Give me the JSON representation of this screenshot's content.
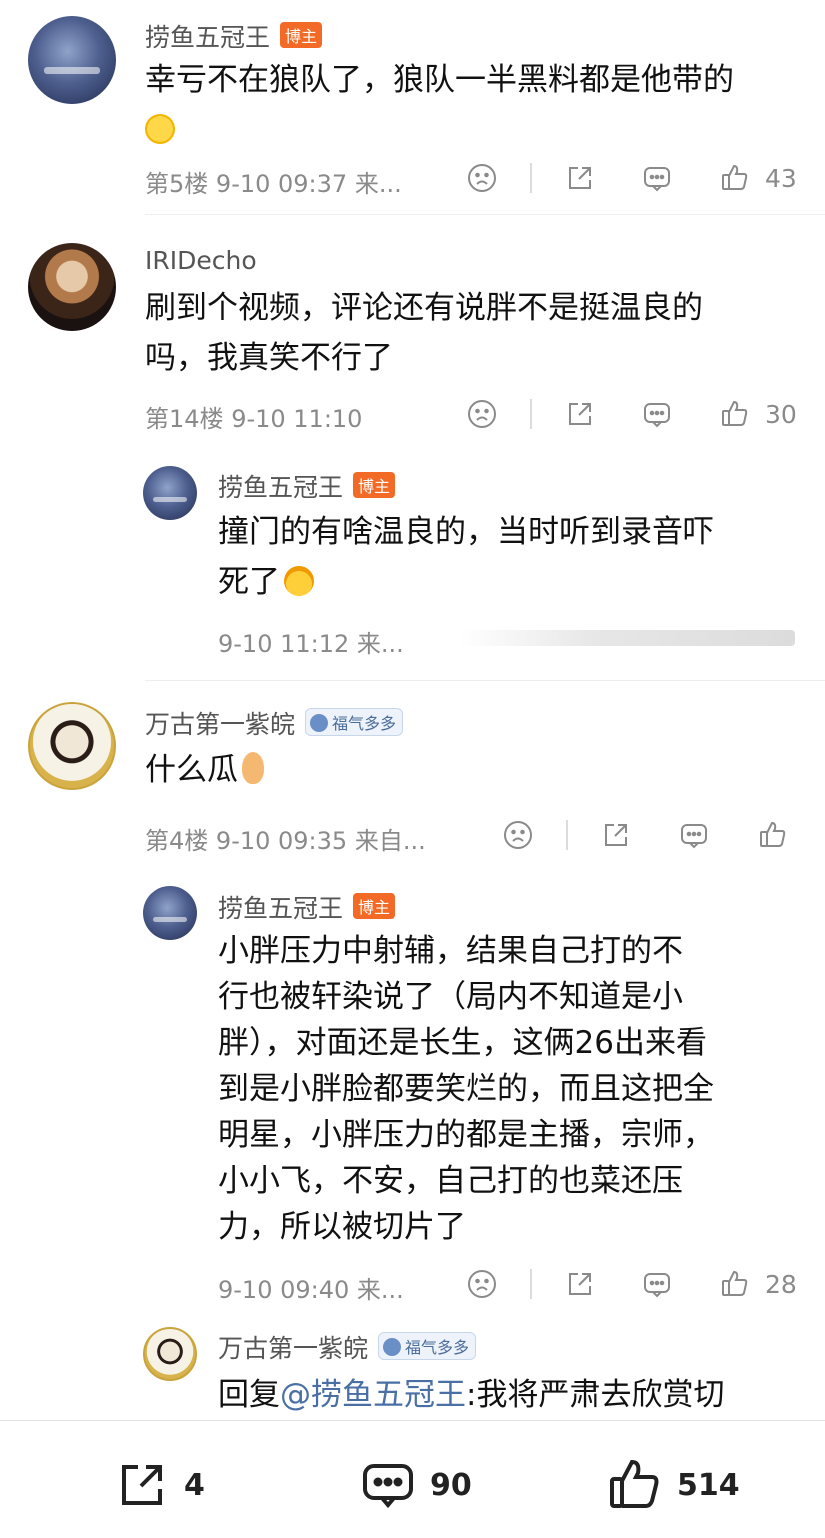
{
  "comments": [
    {
      "name": "捞鱼五冠王",
      "badge": "博主",
      "text_l1": "幸亏不在狼队了，狼队一半黑料都是他带的",
      "floor": "第5楼",
      "time": "9-10 09:37",
      "source": "来...",
      "likes": "43"
    },
    {
      "name": "IRIDecho",
      "text_l1": "刷到个视频，评论还有说胖不是挺温良的",
      "text_l2": "吗，我真笑不行了",
      "floor": "第14楼",
      "time": "9-10 11:10",
      "likes": "30"
    },
    {
      "name": "捞鱼五冠王",
      "badge": "博主",
      "text_l1": "撞门的有啥温良的，当时听到录音吓",
      "text_l2": "死了",
      "time": "9-10 11:12",
      "source": "来..."
    },
    {
      "name": "万古第一紫皖",
      "badge": "福气多多",
      "text_l1": "什么瓜",
      "floor": "第4楼",
      "time": "9-10 09:35",
      "source": "来自..."
    },
    {
      "name": "捞鱼五冠王",
      "badge": "博主",
      "lines": [
        "小胖压力中射辅，结果自己打的不",
        "行也被轩染说了（局内不知道是小",
        "胖），对面还是长生，这俩26出来看",
        "到是小胖脸都要笑烂的，而且这把全",
        "明星，小胖压力的都是主播，宗师，",
        "小小飞，不安，自己打的也菜还压",
        "力，所以被切片了"
      ],
      "time": "9-10 09:40",
      "source": "来...",
      "likes": "28"
    },
    {
      "name": "万古第一紫皖",
      "badge": "福气多多",
      "reply_prefix": "回复",
      "mention": "@捞鱼五冠王",
      "reply_text": ":我将严肃去欣赏切"
    }
  ],
  "bottom": {
    "share_count": "4",
    "comment_count": "90",
    "like_count": "514"
  },
  "icons": {
    "react": "sad-face-icon",
    "share": "share-icon",
    "comment": "comment-icon",
    "like": "thumbs-up-icon"
  }
}
